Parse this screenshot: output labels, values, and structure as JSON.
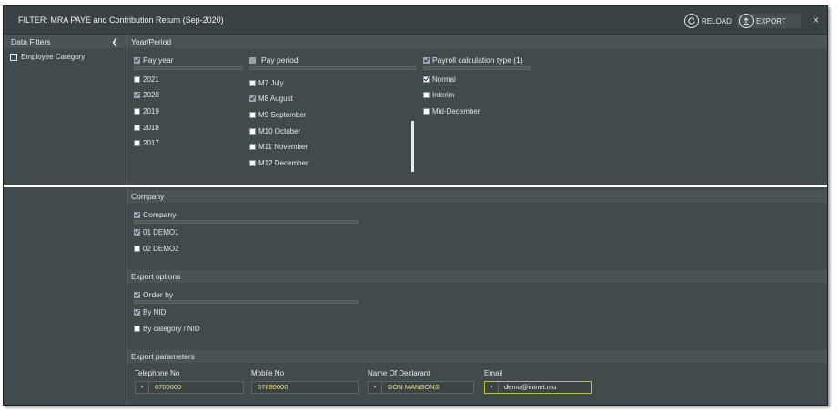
{
  "window": {
    "title": "FILTER: MRA PAYE and Contribution Return (Sep-2020)",
    "reload_label": "RELOAD",
    "export_label": "EXPORT",
    "close_symbol": "×"
  },
  "sidebar": {
    "header": "Data Filters",
    "collapse_symbol": "❮",
    "items": [
      {
        "label": "Employee Category"
      }
    ]
  },
  "year_period": {
    "header": "Year/Period",
    "pay_year": {
      "label": "Pay year",
      "options": [
        {
          "label": "2021",
          "checked": false
        },
        {
          "label": "2020",
          "checked": true
        },
        {
          "label": "2019",
          "checked": false
        },
        {
          "label": "2018",
          "checked": false
        },
        {
          "label": "2017",
          "checked": false
        }
      ]
    },
    "pay_period": {
      "label": "Pay period",
      "options": [
        {
          "label": "M7 July",
          "checked": false
        },
        {
          "label": "M8 August",
          "checked": true
        },
        {
          "label": "M9 September",
          "checked": false
        },
        {
          "label": "M10 October",
          "checked": false
        },
        {
          "label": "M11 November",
          "checked": false
        },
        {
          "label": "M12 December",
          "checked": false
        }
      ]
    },
    "payroll_type": {
      "label": "Payroll calculation type (1)",
      "options": [
        {
          "label": "Normal",
          "checked": true
        },
        {
          "label": "Interim",
          "checked": false
        },
        {
          "label": "Mid-December",
          "checked": false
        }
      ]
    }
  },
  "company": {
    "header": "Company",
    "group_label": "Company",
    "options": [
      {
        "label": "01 DEMO1",
        "checked": true
      },
      {
        "label": "02 DEMO2",
        "checked": false
      }
    ]
  },
  "export_options": {
    "header": "Export options",
    "group_label": "Order by",
    "options": [
      {
        "label": "By NID",
        "checked": true
      },
      {
        "label": "By category / NID",
        "checked": false
      }
    ]
  },
  "export_parameters": {
    "header": "Export parameters",
    "fields": [
      {
        "label": "Telephone No",
        "value": "6700000",
        "dropdown": true
      },
      {
        "label": "Mobile No",
        "value": "57890000",
        "dropdown": false
      },
      {
        "label": "Name Of Declarant",
        "value": "DON MANSONS",
        "dropdown": true
      },
      {
        "label": "Email",
        "value": "demo@intnet.mu",
        "dropdown": true
      }
    ]
  },
  "icons": {
    "reload": "reload-icon",
    "export": "export-icon",
    "close": "close-icon",
    "collapse": "chevron-left-icon"
  },
  "colors": {
    "panel": "#414a4c",
    "highlight_field": "#b8c33a",
    "field_text": "#e8e28a"
  }
}
